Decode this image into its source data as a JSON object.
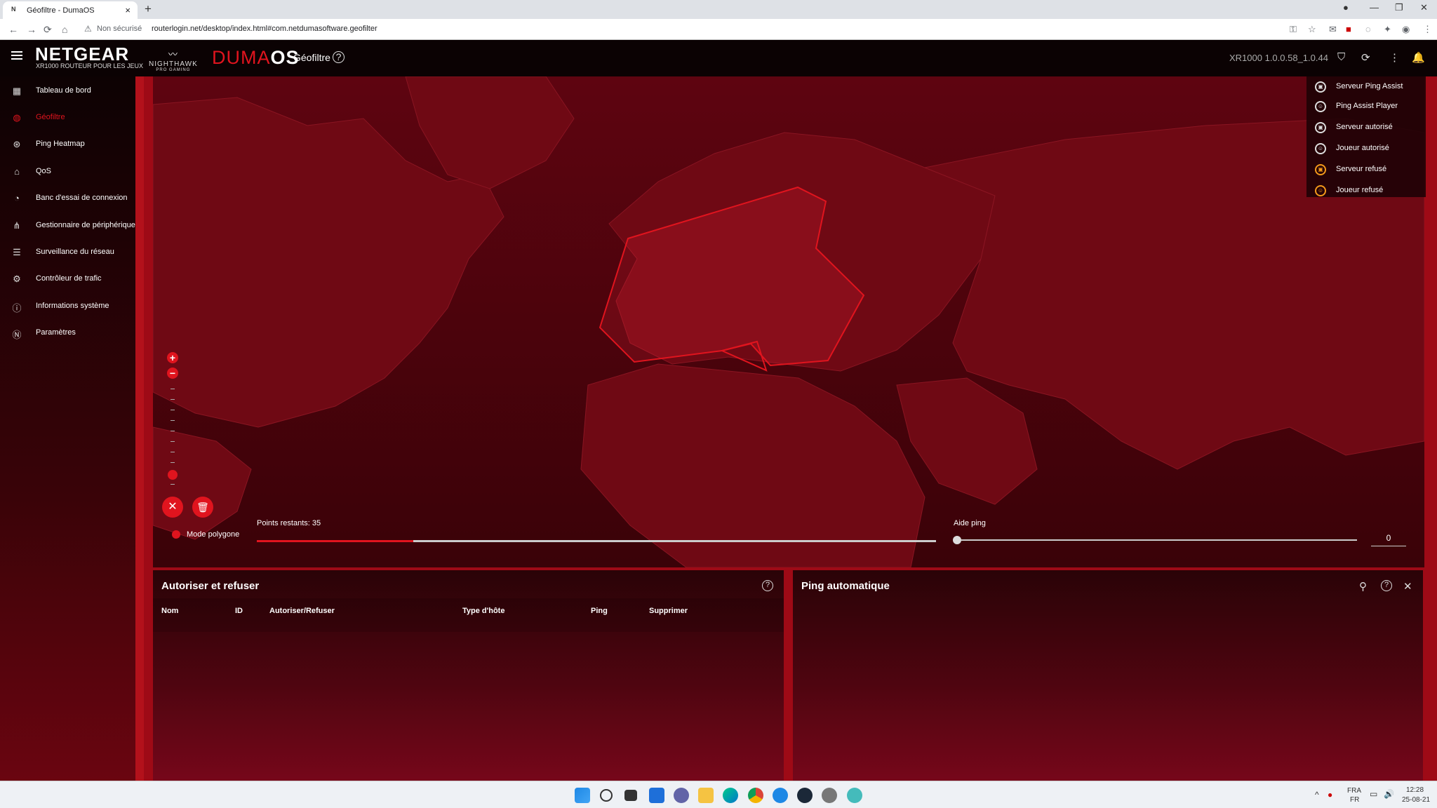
{
  "browser": {
    "tab_favicon": "N",
    "tab_title": "Géofiltre - DumaOS",
    "tab_close": "×",
    "new_tab": "+",
    "security_label": "Non sécurisé",
    "url": "routerlogin.net/desktop/index.html#com.netdumasoftware.geofilter"
  },
  "header": {
    "brand": "NETGEAR",
    "brand_subtitle": "XR1000 ROUTEUR POUR LES JEUX",
    "partner_logo": "NIGHTHAWK",
    "partner_sub": "PRO GAMING",
    "os_name_prefix": "DUMA",
    "os_name_suffix": "OS",
    "page_title": "Géofiltre",
    "firmware_version": "XR1000 1.0.0.58_1.0.44"
  },
  "sidebar": {
    "items": [
      {
        "label": "Tableau de bord",
        "icon": "dashboard-icon"
      },
      {
        "label": "Géofiltre",
        "icon": "geofilter-icon",
        "active": true
      },
      {
        "label": "Ping Heatmap",
        "icon": "heatmap-icon"
      },
      {
        "label": "QoS",
        "icon": "qos-icon"
      },
      {
        "label": "Banc d'essai de connexion",
        "icon": "speedometer-icon"
      },
      {
        "label": "Gestionnaire de périphériques",
        "icon": "device-tree-icon"
      },
      {
        "label": "Surveillance du réseau",
        "icon": "network-monitor-icon"
      },
      {
        "label": "Contrôleur de trafic",
        "icon": "traffic-controller-icon"
      },
      {
        "label": "Informations système",
        "icon": "system-info-icon"
      },
      {
        "label": "Paramètres",
        "icon": "settings-icon"
      }
    ]
  },
  "legend": {
    "items": [
      {
        "label": "Serveur Ping Assist",
        "icon": "server-ping-assist-icon"
      },
      {
        "label": "Ping Assist Player",
        "icon": "player-ping-assist-icon"
      },
      {
        "label": "Serveur autorisé",
        "icon": "server-allowed-icon"
      },
      {
        "label": "Joueur autorisé",
        "icon": "player-allowed-icon"
      },
      {
        "label": "Serveur refusé",
        "icon": "server-denied-icon"
      },
      {
        "label": "Joueur refusé",
        "icon": "player-denied-icon"
      }
    ]
  },
  "map_controls": {
    "zoom_in": "+",
    "zoom_out": "−",
    "cancel": "✕",
    "delete": "🗑",
    "polygon_mode_label": "Mode polygone",
    "points_remaining_label": "Points restants: 35",
    "ping_slider_fill_fraction": 0.23,
    "aide_ping_label": "Aide ping",
    "aide_ping_value": "0",
    "accent_color": "#e0141e"
  },
  "panels": {
    "allow_deny": {
      "title": "Autoriser et refuser",
      "columns": [
        "Nom",
        "ID",
        "Autoriser/Refuser",
        "Type d'hôte",
        "Ping",
        "Supprimer"
      ]
    },
    "auto_ping": {
      "title": "Ping automatique"
    }
  },
  "taskbar": {
    "language": "FRA",
    "language_sub": "FR",
    "time": "12:28",
    "date": "25-08-21"
  }
}
